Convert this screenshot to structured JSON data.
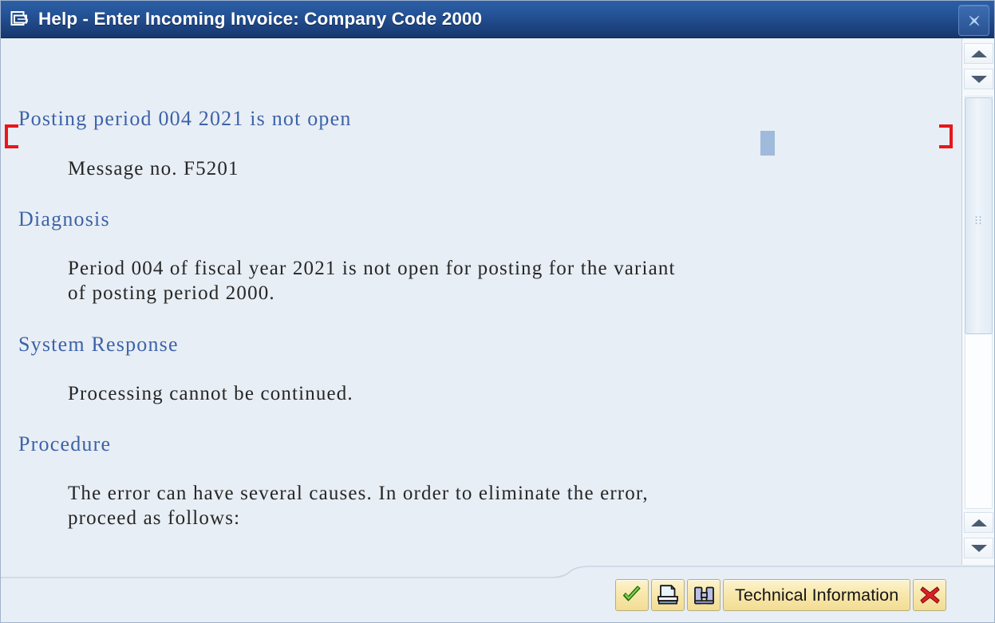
{
  "window": {
    "title": "Help - Enter Incoming Invoice: Company Code 2000",
    "title_icon": "help-document-icon",
    "close_icon": "close-x-icon",
    "background_color": "#e8eef5",
    "titlebar_color": "#1d4380"
  },
  "help": {
    "message_heading": "Posting period 004 2021 is not open",
    "message_number_line": "Message no. F5201",
    "sections": [
      {
        "heading": "Diagnosis",
        "lines": [
          "Period 004 of fiscal year 2021 is not open for posting for the variant",
          "of posting period 2000."
        ]
      },
      {
        "heading": "System Response",
        "lines": [
          "Processing cannot be continued."
        ]
      },
      {
        "heading": "Procedure",
        "lines": [
          "The error can have several causes. In order to eliminate the error,",
          "proceed as follows:"
        ]
      }
    ],
    "heading_color": "#3c63a8",
    "body_color": "#262626",
    "marker_color": "#e8161a"
  },
  "scrollbars": {
    "top_up_icon": "scroll-up-arrow-icon",
    "top_down_icon": "scroll-down-arrow-icon",
    "bottom_up_icon": "scroll-up-arrow-icon",
    "bottom_down_icon": "scroll-down-arrow-icon",
    "thumb_grip_icon": "scrollbar-grip-icon"
  },
  "footer": {
    "buttons": [
      {
        "name": "continue-button",
        "icon": "green-check-icon",
        "label": ""
      },
      {
        "name": "print-button",
        "icon": "printer-icon",
        "label": ""
      },
      {
        "name": "find-button",
        "icon": "binoculars-icon",
        "label": ""
      },
      {
        "name": "technical-information-button",
        "icon": "",
        "label": "Technical Information"
      },
      {
        "name": "cancel-button",
        "icon": "red-x-icon",
        "label": ""
      }
    ],
    "button_face_color": "#f7e6a8"
  }
}
